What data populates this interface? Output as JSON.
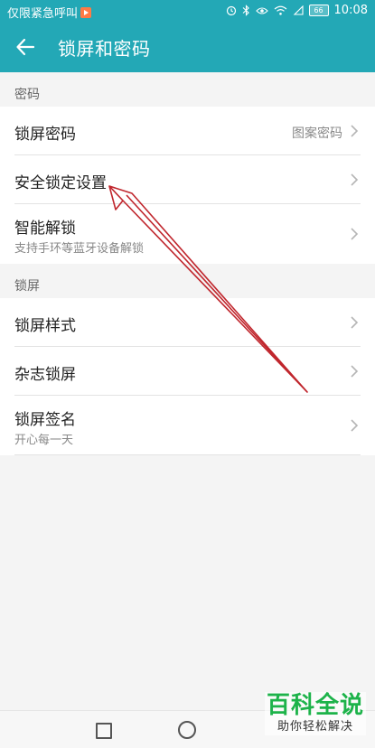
{
  "status_bar": {
    "carrier_text": "仅限紧急呼叫",
    "battery_level": "66",
    "time": "10:08"
  },
  "header": {
    "title": "锁屏和密码"
  },
  "sections": [
    {
      "label": "密码",
      "items": [
        {
          "title": "锁屏密码",
          "value": "图案密码"
        },
        {
          "title": "安全锁定设置"
        },
        {
          "title": "智能解锁",
          "subtitle": "支持手环等蓝牙设备解锁"
        }
      ]
    },
    {
      "label": "锁屏",
      "items": [
        {
          "title": "锁屏样式"
        },
        {
          "title": "杂志锁屏"
        },
        {
          "title": "锁屏签名",
          "subtitle": "开心每一天"
        }
      ]
    }
  ],
  "watermark": {
    "title": "百科全说",
    "subtitle": "助你轻松解决"
  },
  "colors": {
    "header_bg": "#23a8b6",
    "annotation_arrow": "#c0262d",
    "watermark_green": "#1db34a"
  },
  "icons": {
    "back": "arrow-left-icon",
    "chevron": "chevron-right-icon",
    "nav_recent": "square-icon",
    "nav_home": "circle-icon"
  }
}
